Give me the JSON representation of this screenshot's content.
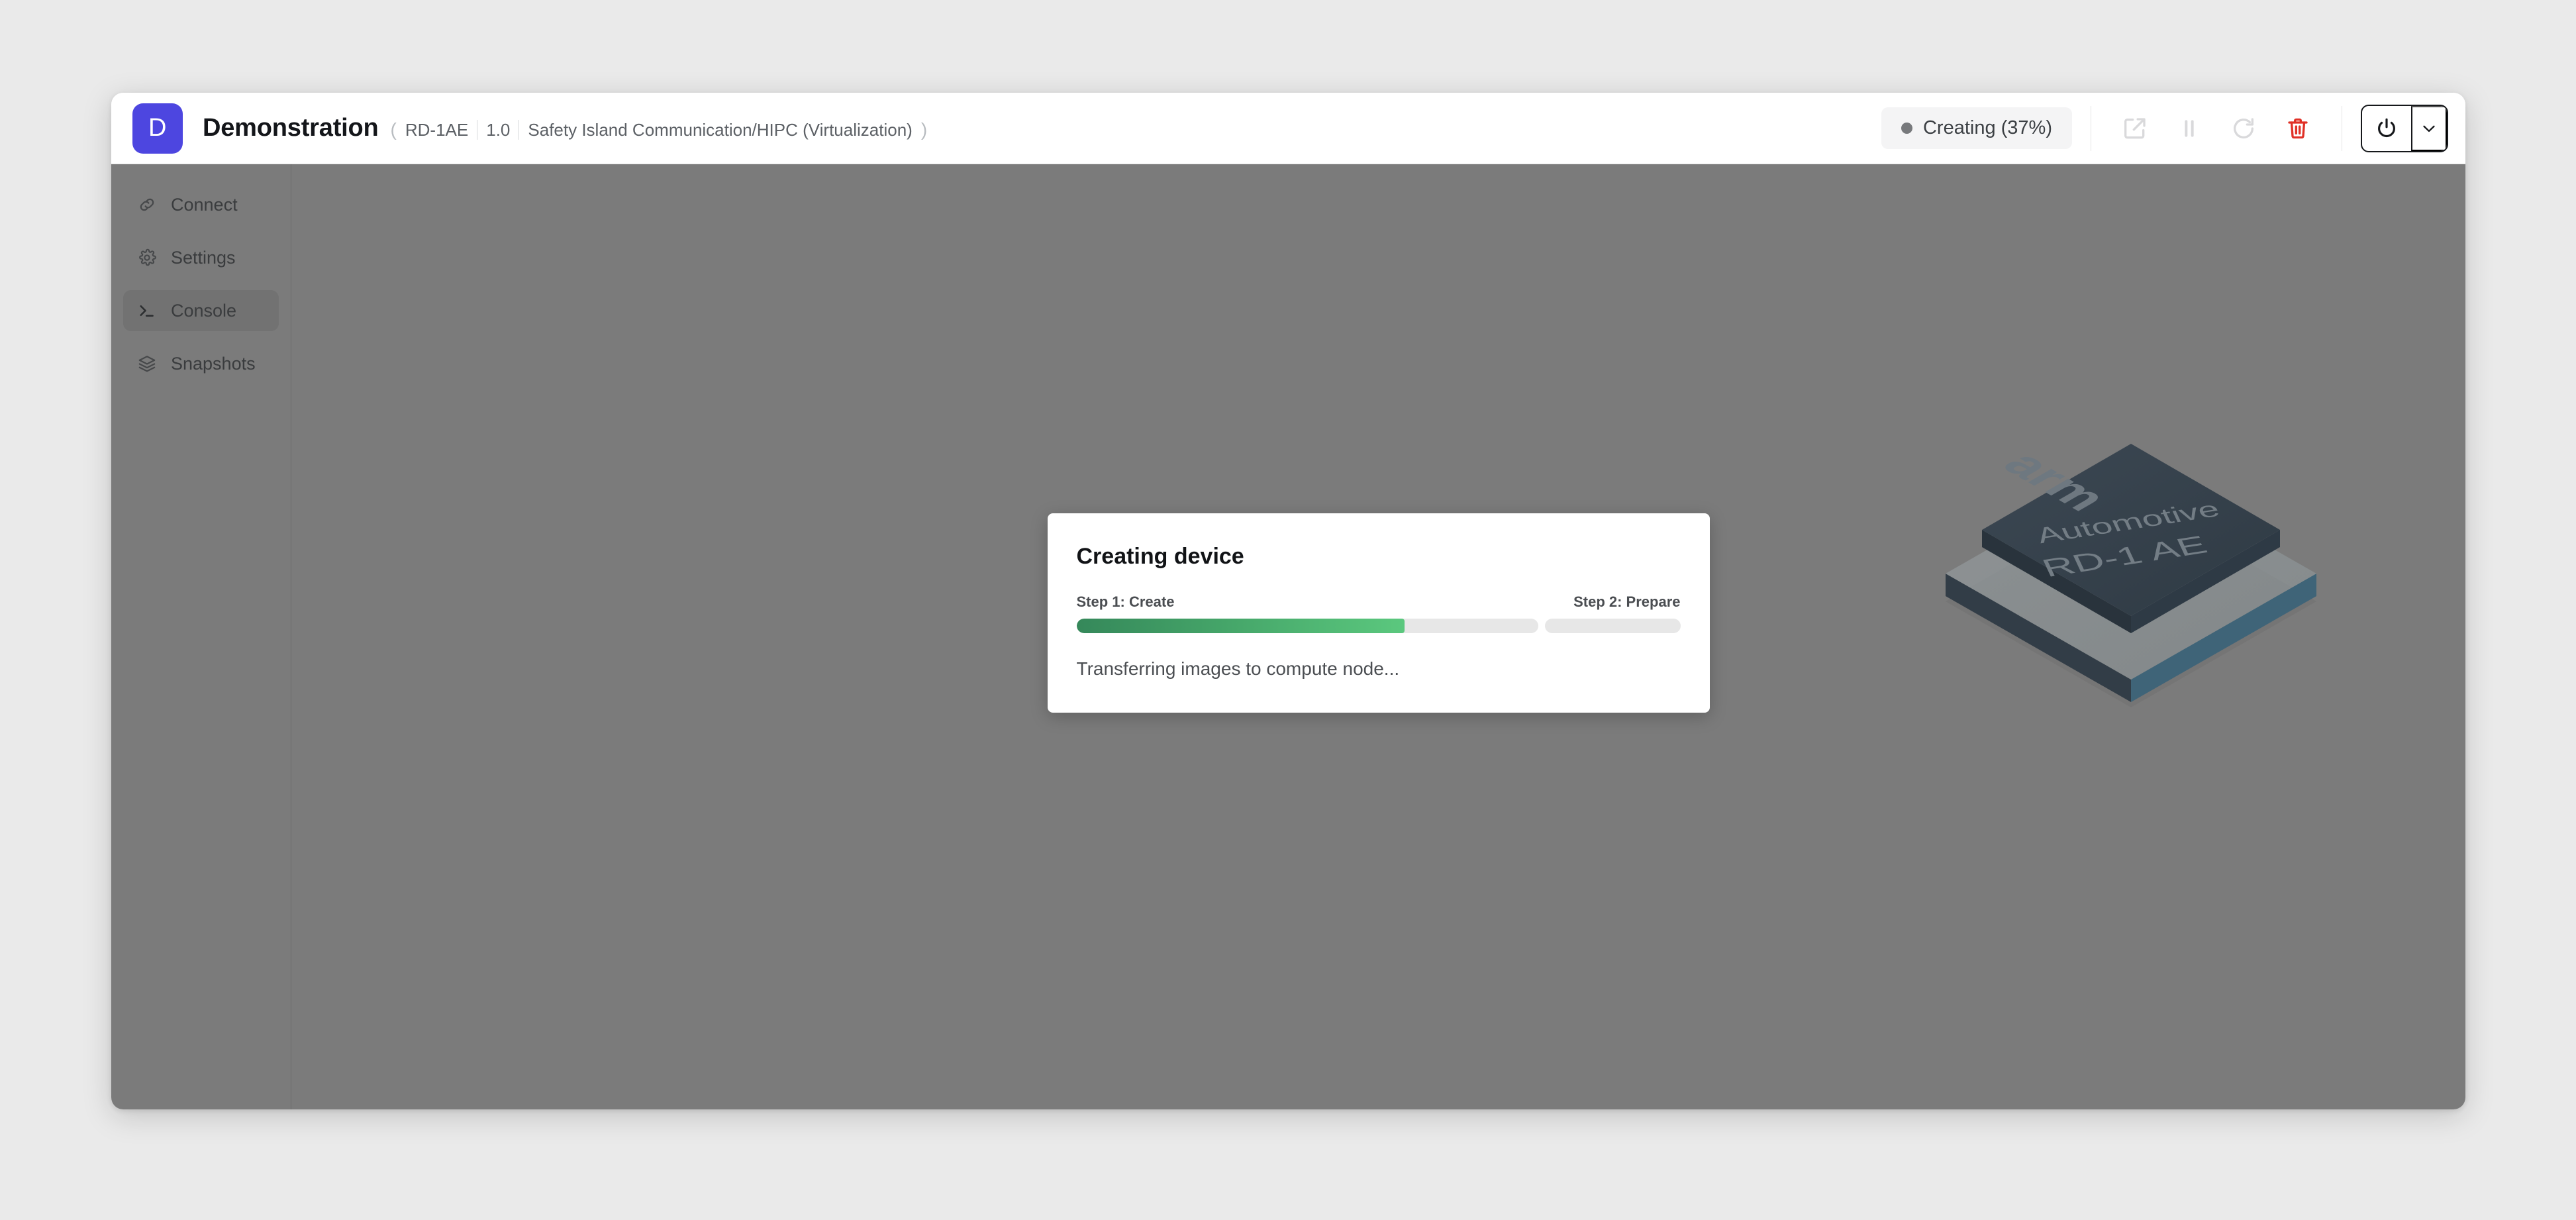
{
  "window": {
    "avatar_letter": "D",
    "title": "Demonstration",
    "breadcrumb": {
      "open_paren": "(",
      "close_paren": ")",
      "items": [
        "RD-1AE",
        "1.0",
        "Safety Island Communication/HIPC (Virtualization)"
      ]
    }
  },
  "toolbar": {
    "status": {
      "label": "Creating (37%)",
      "dot_color": "#77797c",
      "background": "#f4f4f5"
    },
    "buttons": [
      {
        "name": "open-external-icon",
        "title": "Open in new window",
        "state": "disabled"
      },
      {
        "name": "pause-icon",
        "title": "Pause",
        "state": "disabled"
      },
      {
        "name": "refresh-icon",
        "title": "Restart",
        "state": "disabled"
      },
      {
        "name": "trash-icon",
        "title": "Delete",
        "state": "danger"
      }
    ],
    "power": {
      "name": "power-icon",
      "title": "Power",
      "caret": "chevron-down-icon"
    },
    "colors": {
      "disabled": "#d9d9db",
      "danger": "#e03127",
      "power_border": "#16181b"
    }
  },
  "sidebar": {
    "items": [
      {
        "label": "Connect",
        "icon": "link-icon",
        "active": false
      },
      {
        "label": "Settings",
        "icon": "gear-icon",
        "active": false
      },
      {
        "label": "Console",
        "icon": "terminal-icon",
        "active": true
      },
      {
        "label": "Snapshots",
        "icon": "layers-icon",
        "active": false
      }
    ]
  },
  "modal": {
    "title": "Creating device",
    "step_1_label": "Step 1: Create",
    "step_2_label": "Step 2: Prepare",
    "step_1_percent": 71,
    "step_2_percent": 0,
    "status_text": "Transferring images to compute node...",
    "progress_colors": {
      "fill_start": "#35885a",
      "fill_end": "#5bc87e",
      "track": "#e7e7e7"
    }
  },
  "stage": {
    "background": "#7b7b7b",
    "chip": {
      "brand": "arm",
      "line_1": "Automotive",
      "line_2": "RD-1 AE",
      "die_color": "#36414c",
      "edge_color": "#3f6478"
    }
  },
  "page": {
    "background": "#eaeaea"
  }
}
